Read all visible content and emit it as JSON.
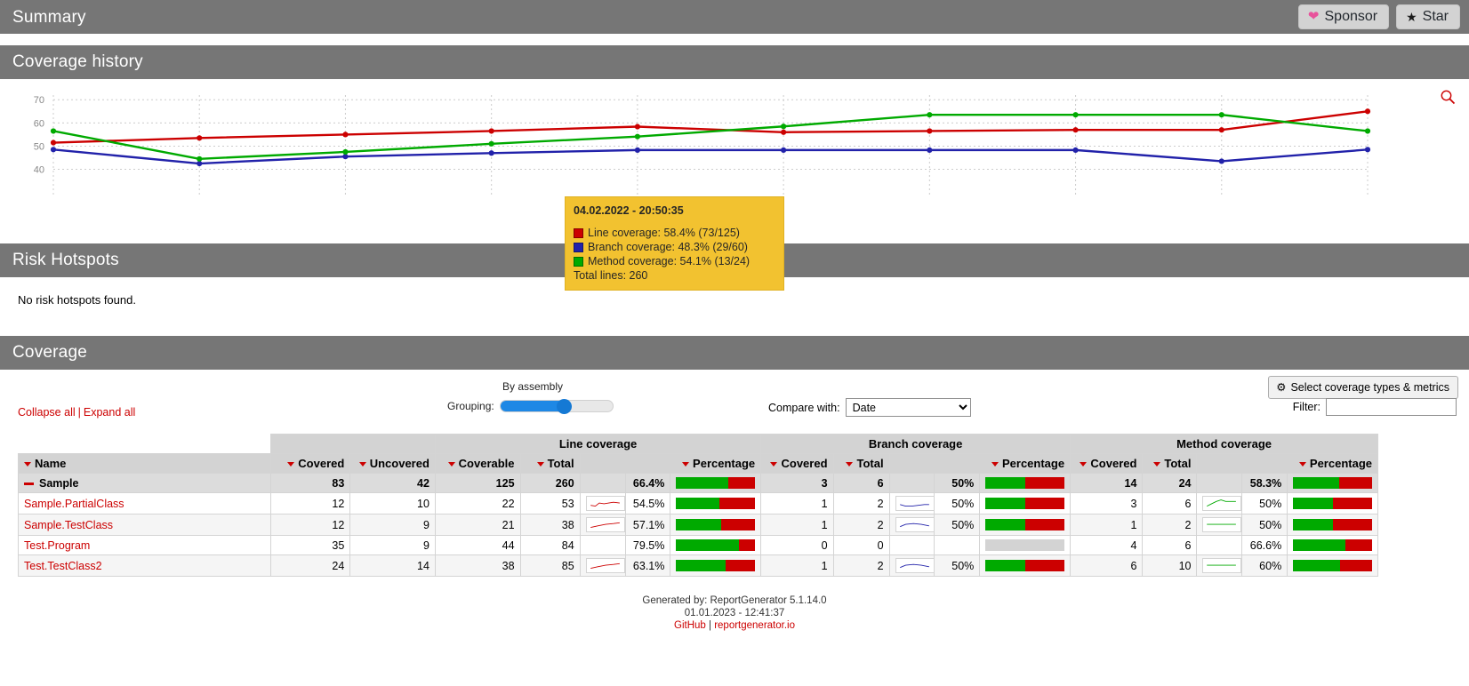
{
  "header": {
    "title": "Summary",
    "sponsor_label": "Sponsor",
    "star_label": "Star"
  },
  "sections": {
    "coverage_history": "Coverage history",
    "risk_hotspots": "Risk Hotspots",
    "coverage": "Coverage"
  },
  "risk_hotspots": {
    "empty_message": "No risk hotspots found."
  },
  "tooltip": {
    "title": "04.02.2022 - 20:50:35",
    "line": "Line coverage: 58.4% (73/125)",
    "branch": "Branch coverage: 48.3% (29/60)",
    "method": "Method coverage: 54.1% (13/24)",
    "total": "Total lines: 260",
    "line_color": "#cc0000",
    "branch_color": "#2222aa",
    "method_color": "#00aa00",
    "bg_color": "#f2c230"
  },
  "controls": {
    "metrics_button": "Select coverage types & metrics",
    "collapse_all": "Collapse all",
    "expand_all": "Expand all",
    "separator": "|",
    "grouping_label": "Grouping:",
    "grouping_value": "By assembly",
    "compare_label": "Compare with:",
    "compare_value": "Date",
    "compare_options": [
      "Date"
    ],
    "filter_label": "Filter:",
    "filter_value": "",
    "filter_placeholder": ""
  },
  "table": {
    "group_headers": {
      "line": "Line coverage",
      "branch": "Branch coverage",
      "method": "Method coverage"
    },
    "columns": {
      "name": "Name",
      "line_covered": "Covered",
      "line_uncovered": "Uncovered",
      "line_coverable": "Coverable",
      "line_total": "Total",
      "line_percentage": "Percentage",
      "branch_covered": "Covered",
      "branch_total": "Total",
      "branch_percentage": "Percentage",
      "method_covered": "Covered",
      "method_total": "Total",
      "method_percentage": "Percentage"
    },
    "rows": [
      {
        "name": "Sample",
        "is_total": true,
        "line_covered": "83",
        "line_uncovered": "42",
        "line_coverable": "125",
        "line_total": "260",
        "line_percentage": "66.4%",
        "line_pct_value": 66.4,
        "line_spark": false,
        "branch_covered": "3",
        "branch_total": "6",
        "branch_percentage": "50%",
        "branch_pct_value": 50,
        "branch_spark": false,
        "method_covered": "14",
        "method_total": "24",
        "method_percentage": "58.3%",
        "method_pct_value": 58.3,
        "method_spark": false
      },
      {
        "name": "Sample.PartialClass",
        "is_total": false,
        "line_covered": "12",
        "line_uncovered": "10",
        "line_coverable": "22",
        "line_total": "53",
        "line_percentage": "54.5%",
        "line_pct_value": 54.5,
        "line_spark": true,
        "branch_covered": "1",
        "branch_total": "2",
        "branch_percentage": "50%",
        "branch_pct_value": 50,
        "branch_spark": true,
        "method_covered": "3",
        "method_total": "6",
        "method_percentage": "50%",
        "method_pct_value": 50,
        "method_spark": true
      },
      {
        "name": "Sample.TestClass",
        "is_total": false,
        "line_covered": "12",
        "line_uncovered": "9",
        "line_coverable": "21",
        "line_total": "38",
        "line_percentage": "57.1%",
        "line_pct_value": 57.1,
        "line_spark": true,
        "branch_covered": "1",
        "branch_total": "2",
        "branch_percentage": "50%",
        "branch_pct_value": 50,
        "branch_spark": true,
        "method_covered": "1",
        "method_total": "2",
        "method_percentage": "50%",
        "method_pct_value": 50,
        "method_spark": true
      },
      {
        "name": "Test.Program",
        "is_total": false,
        "line_covered": "35",
        "line_uncovered": "9",
        "line_coverable": "44",
        "line_total": "84",
        "line_percentage": "79.5%",
        "line_pct_value": 79.5,
        "line_spark": false,
        "branch_covered": "0",
        "branch_total": "0",
        "branch_percentage": "",
        "branch_pct_value": null,
        "branch_spark": false,
        "method_covered": "4",
        "method_total": "6",
        "method_percentage": "66.6%",
        "method_pct_value": 66.6,
        "method_spark": false
      },
      {
        "name": "Test.TestClass2",
        "is_total": false,
        "line_covered": "24",
        "line_uncovered": "14",
        "line_coverable": "38",
        "line_total": "85",
        "line_percentage": "63.1%",
        "line_pct_value": 63.1,
        "line_spark": true,
        "branch_covered": "1",
        "branch_total": "2",
        "branch_percentage": "50%",
        "branch_pct_value": 50,
        "branch_spark": true,
        "method_covered": "6",
        "method_total": "10",
        "method_percentage": "60%",
        "method_pct_value": 60,
        "method_spark": true
      }
    ]
  },
  "footer": {
    "generated_by": "Generated by: ReportGenerator 5.1.14.0",
    "timestamp": "01.01.2023 - 12:41:37",
    "github": "GitHub",
    "separator": "|",
    "site": "reportgenerator.io"
  },
  "chart_data": {
    "type": "line",
    "title": "Coverage history",
    "xlabel": "",
    "ylabel": "",
    "ylim": [
      36,
      72
    ],
    "yticks": [
      40,
      50,
      60,
      70
    ],
    "grid": true,
    "legend": "none",
    "x": [
      1,
      2,
      3,
      4,
      5,
      6,
      7,
      8,
      9,
      10
    ],
    "series": [
      {
        "name": "Line coverage",
        "color": "#cc0000",
        "values": [
          51.5,
          53.5,
          55.0,
          56.5,
          58.4,
          56.0,
          56.5,
          57.0,
          57.0,
          65.0
        ]
      },
      {
        "name": "Branch coverage",
        "color": "#2222aa",
        "values": [
          48.5,
          42.5,
          45.5,
          47.0,
          48.3,
          48.3,
          48.3,
          48.3,
          43.5,
          48.5
        ]
      },
      {
        "name": "Method coverage",
        "color": "#00aa00",
        "values": [
          56.5,
          44.5,
          47.5,
          51.0,
          54.1,
          58.5,
          63.5,
          63.5,
          63.5,
          56.5
        ]
      }
    ]
  },
  "icons": {
    "zoom": "magnifier-icon",
    "gear": "gear-icon",
    "heart": "heart-icon",
    "star": "star-icon"
  }
}
